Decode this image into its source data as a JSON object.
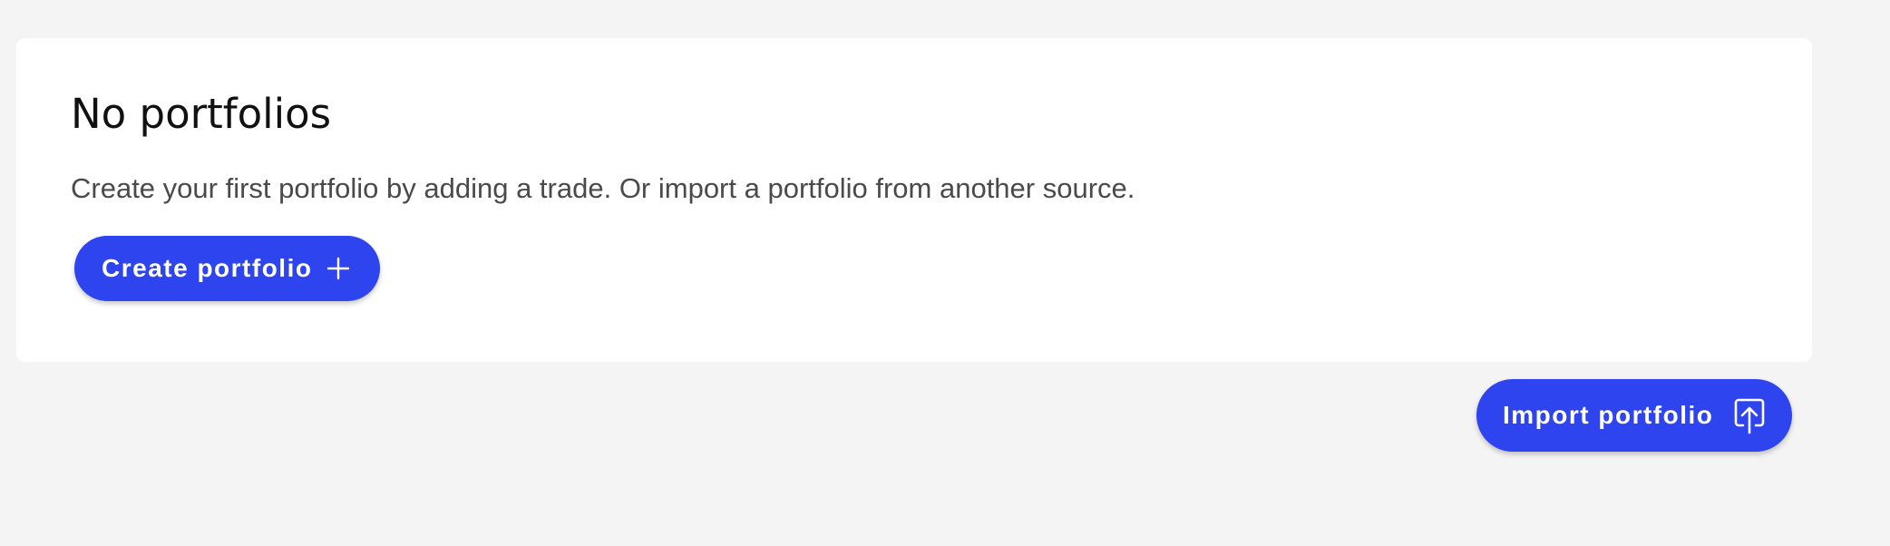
{
  "empty_state": {
    "title": "No portfolios",
    "description": "Create your first portfolio by adding a trade. Or import a portfolio from another source.",
    "create_button": {
      "label": "Create portfolio",
      "icon": "plus-icon"
    }
  },
  "import_button": {
    "label": "Import portfolio",
    "icon": "upload-icon"
  },
  "colors": {
    "accent": "#2e44ee",
    "page_background": "#f4f4f4",
    "card_background": "#ffffff",
    "title_text": "#111111",
    "body_text": "#4a4a4a"
  }
}
